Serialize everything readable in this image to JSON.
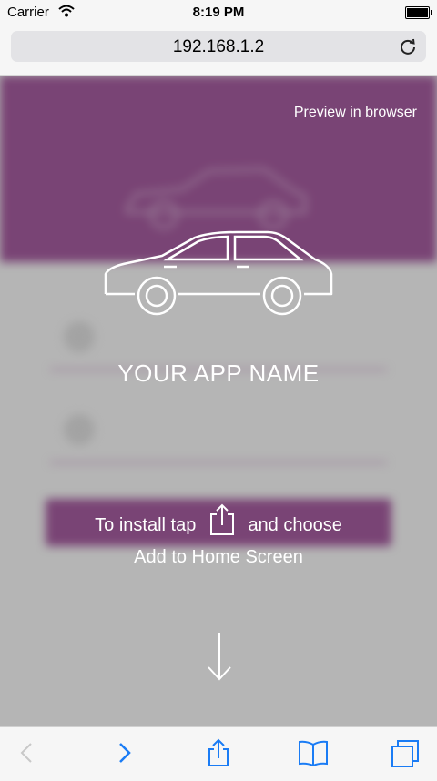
{
  "status_bar": {
    "carrier": "Carrier",
    "time": "8:19 PM"
  },
  "url_bar": {
    "url": "192.168.1.2"
  },
  "content": {
    "preview_link": "Preview in browser",
    "app_name": "YOUR APP NAME",
    "install_prefix": "To install tap",
    "install_suffix": "and choose",
    "add_to_home": "Add to Home Screen"
  },
  "colors": {
    "brand": "#7b1a73",
    "overlay_text": "#ffffff"
  },
  "icons": [
    "wifi-icon",
    "battery-icon",
    "reload-icon",
    "car-icon",
    "share-icon",
    "arrow-down-icon",
    "back-icon",
    "forward-icon",
    "bookmarks-icon",
    "tabs-icon"
  ]
}
